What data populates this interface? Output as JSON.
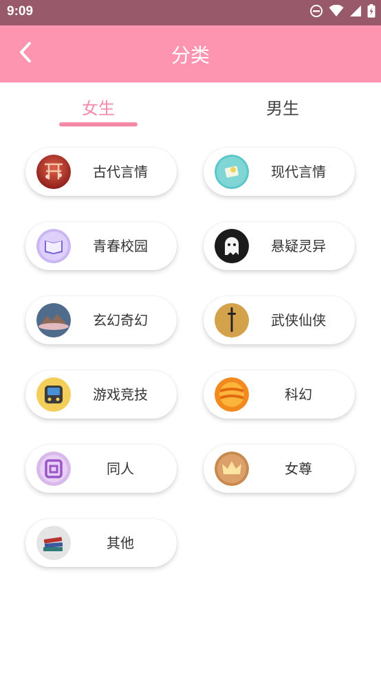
{
  "status_bar": {
    "time": "9:09"
  },
  "app_bar": {
    "title": "分类"
  },
  "tabs": [
    {
      "label": "女生",
      "selected": true
    },
    {
      "label": "男生",
      "selected": false
    }
  ],
  "categories": [
    {
      "label": "古代言情",
      "icon": "ancient-romance-icon"
    },
    {
      "label": "现代言情",
      "icon": "modern-romance-icon"
    },
    {
      "label": "青春校园",
      "icon": "campus-book-icon"
    },
    {
      "label": "悬疑灵异",
      "icon": "ghost-icon"
    },
    {
      "label": "玄幻奇幻",
      "icon": "fantasy-mountain-icon"
    },
    {
      "label": "武侠仙侠",
      "icon": "sword-icon"
    },
    {
      "label": "游戏竞技",
      "icon": "game-console-icon"
    },
    {
      "label": "科幻",
      "icon": "planet-icon"
    },
    {
      "label": "同人",
      "icon": "doujin-badge-icon"
    },
    {
      "label": "女尊",
      "icon": "crown-icon"
    },
    {
      "label": "其他",
      "icon": "books-icon"
    }
  ],
  "colors": {
    "accent": "#f48aa7",
    "app_bar": "#fe95b0",
    "status_bar": "#98596a"
  }
}
